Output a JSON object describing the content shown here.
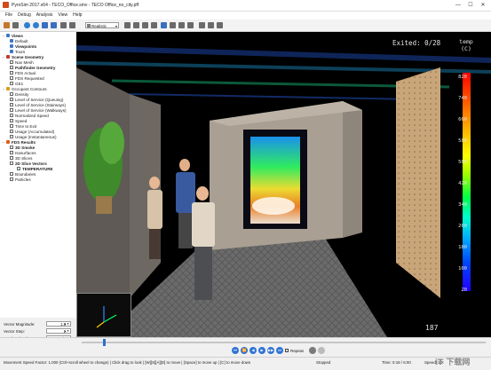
{
  "window": {
    "title": "PyroSim 2017.x64 - TECO_Office.smv - TECO Office_no_city.pff",
    "controls": [
      "—",
      "☐",
      "✕"
    ]
  },
  "menu": [
    "File",
    "Debug",
    "Analysis",
    "View",
    "Help"
  ],
  "toolbar": {
    "view_mode": "Realistic"
  },
  "tree": [
    {
      "label": "Views",
      "bold": true,
      "level": 0,
      "kind": "folder"
    },
    {
      "label": "Default",
      "level": 1,
      "kind": "view"
    },
    {
      "label": "Viewpoints",
      "bold": true,
      "level": 1,
      "kind": "view"
    },
    {
      "label": "Tours",
      "level": 1,
      "kind": "view"
    },
    {
      "label": "Scene Geometry",
      "bold": true,
      "level": 0,
      "kind": "folder"
    },
    {
      "label": "Nav Mesh",
      "level": 1,
      "kind": "check",
      "checked": false
    },
    {
      "label": "Pathfinder Geometry",
      "bold": true,
      "level": 1,
      "kind": "check",
      "checked": true
    },
    {
      "label": "FDS Actual",
      "level": 1,
      "kind": "check",
      "checked": false
    },
    {
      "label": "FDS Requested",
      "level": 1,
      "kind": "check",
      "checked": false
    },
    {
      "label": "GE1",
      "level": 1,
      "kind": "check",
      "checked": false
    },
    {
      "label": "Occupant Contours",
      "level": 0,
      "kind": "folder"
    },
    {
      "label": "Density",
      "level": 1,
      "kind": "check",
      "checked": false
    },
    {
      "label": "Level of Service (Queuing)",
      "level": 1,
      "kind": "check",
      "checked": false
    },
    {
      "label": "Level of Service (Stairways)",
      "level": 1,
      "kind": "check",
      "checked": false
    },
    {
      "label": "Level of Service (Walkways)",
      "level": 1,
      "kind": "check",
      "checked": false
    },
    {
      "label": "Normalized Speed",
      "level": 1,
      "kind": "check",
      "checked": false
    },
    {
      "label": "Speed",
      "level": 1,
      "kind": "check",
      "checked": false
    },
    {
      "label": "Time to Exit",
      "level": 1,
      "kind": "check",
      "checked": false
    },
    {
      "label": "Usage (Accumulated)",
      "level": 1,
      "kind": "check",
      "checked": false
    },
    {
      "label": "Usage (Instantaneous)",
      "level": 1,
      "kind": "check",
      "checked": false
    },
    {
      "label": "FDS Results",
      "bold": true,
      "level": 0,
      "kind": "folder"
    },
    {
      "label": "3D Smoke",
      "bold": true,
      "level": 1,
      "kind": "check",
      "checked": true
    },
    {
      "label": "Isosurfaces",
      "level": 1,
      "kind": "check",
      "checked": false
    },
    {
      "label": "3D Slices",
      "level": 1,
      "kind": "check",
      "checked": false
    },
    {
      "label": "2D Slice Vectors",
      "bold": true,
      "level": 1,
      "kind": "check",
      "checked": true
    },
    {
      "label": "TEMPERATURE",
      "bold": true,
      "level": 2,
      "kind": "check",
      "checked": true
    },
    {
      "label": "Boundaries",
      "level": 1,
      "kind": "check",
      "checked": false
    },
    {
      "label": "Particles",
      "level": 1,
      "kind": "check",
      "checked": false
    }
  ],
  "properties": [
    {
      "label": "Vector Magnitude:",
      "value": "1.5"
    },
    {
      "label": "Vector Step:",
      "value": "1"
    },
    {
      "label": "Smoke3d Style:",
      "value": "GasBin"
    },
    {
      "label": "Fire Brightness (%):",
      "value": "100"
    }
  ],
  "viewport": {
    "exited_text": "Exited: 0/28",
    "colorbar_title": "temp",
    "colorbar_unit": "(C)",
    "colorbar_ticks": [
      "820",
      "740",
      "660",
      "580",
      "500",
      "420",
      "340",
      "260",
      "180",
      "100",
      "20"
    ],
    "timer": "187"
  },
  "playback": {
    "buttons": [
      "⏮",
      "⏪",
      "◀",
      "▶",
      "▶▶",
      "⏭"
    ],
    "repeat_label": "Repeat",
    "progress_fraction": 0.055
  },
  "status": {
    "hint": "Movement Speed Factor: 1.000 (Ctrl+scroll wheel to change) | Click drag to look | [W][S][A][D] to move | [Space] to move up | [C] to move down",
    "state": "Stopped",
    "time": "Time: 0:18 / 6:00",
    "speed": "Speed: 1 X"
  },
  "watermark": "iT 下载网"
}
